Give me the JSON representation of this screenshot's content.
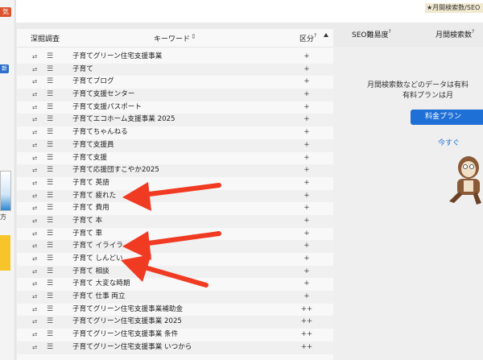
{
  "sidebar": {
    "badge_top": "気",
    "badge_mid": "新",
    "thumb_label": "方"
  },
  "topbar": {
    "badge": "月間検索数/SEO"
  },
  "table": {
    "headers": {
      "col1": "深掘調査",
      "keyword": "キーワード",
      "sort_icon": "⇕",
      "category": "区分",
      "help": "?"
    },
    "rows": [
      {
        "keyword": "子育てグリーン住宅支援事業",
        "cat": "+"
      },
      {
        "keyword": "子育て",
        "cat": "+"
      },
      {
        "keyword": "子育てブログ",
        "cat": "+"
      },
      {
        "keyword": "子育て支援センター",
        "cat": "+"
      },
      {
        "keyword": "子育て支援パスポート",
        "cat": "+"
      },
      {
        "keyword": "子育てエコホーム支援事業 2025",
        "cat": "+"
      },
      {
        "keyword": "子育てちゃんねる",
        "cat": "+"
      },
      {
        "keyword": "子育て支援員",
        "cat": "+"
      },
      {
        "keyword": "子育て支援",
        "cat": "+"
      },
      {
        "keyword": "子育て応援団すこやか2025",
        "cat": "+"
      },
      {
        "keyword": "子育て 英語",
        "cat": "+"
      },
      {
        "keyword": "子育て 疲れた",
        "cat": "+"
      },
      {
        "keyword": "子育て 費用",
        "cat": "+"
      },
      {
        "keyword": "子育て 本",
        "cat": "+"
      },
      {
        "keyword": "子育て 車",
        "cat": "+"
      },
      {
        "keyword": "子育て イライラ",
        "cat": "+"
      },
      {
        "keyword": "子育て しんどい",
        "cat": "+"
      },
      {
        "keyword": "子育て 相談",
        "cat": "+"
      },
      {
        "keyword": "子育て 大変な時期",
        "cat": "+"
      },
      {
        "keyword": "子育て 仕事 両立",
        "cat": "+"
      },
      {
        "keyword": "子育てグリーン住宅支援事業補助金",
        "cat": "++"
      },
      {
        "keyword": "子育てグリーン住宅支援事業 2025",
        "cat": "++"
      },
      {
        "keyword": "子育てグリーン住宅支援事業 条件",
        "cat": "++"
      },
      {
        "keyword": "子育てグリーン住宅支援事業 いつから",
        "cat": "++"
      }
    ]
  },
  "right": {
    "seo_header": "SEO難易度",
    "volume_header": "月間検索数",
    "help": "?",
    "message_line1": "月間検索数などのデータは有料",
    "message_line2": "有料プランは月",
    "plan_button": "料金プラン",
    "link_now": "今すぐ"
  },
  "colors": {
    "accent": "#1e6fd6",
    "arrow": "#f03a22"
  }
}
